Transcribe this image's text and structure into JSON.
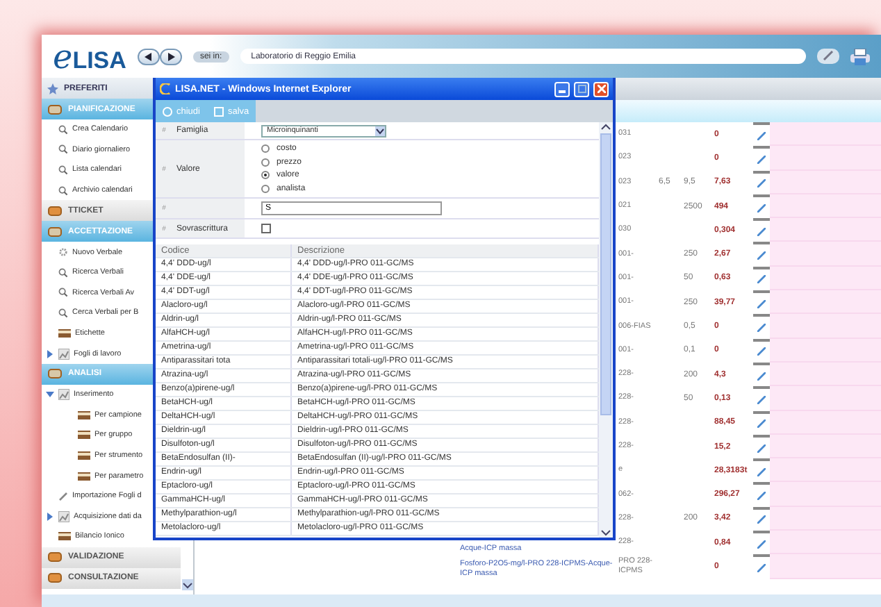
{
  "app": {
    "logo_prefix": "e",
    "logo": "LISA",
    "location_label": "sei in:",
    "location": "Laboratorio di Reggio Emilia"
  },
  "sidebar": {
    "items": [
      {
        "kind": "favorites",
        "label": "PREFERITI"
      },
      {
        "kind": "section",
        "label": "PIANIFICAZIONE",
        "open": true
      },
      {
        "kind": "search",
        "label": "Crea Calendario"
      },
      {
        "kind": "search",
        "label": "Diario giornaliero"
      },
      {
        "kind": "search",
        "label": "Lista calendari"
      },
      {
        "kind": "search",
        "label": "Archivio calendari"
      },
      {
        "kind": "section",
        "label": "TTICKET",
        "open": false
      },
      {
        "kind": "section",
        "label": "ACCETTAZIONE",
        "open": true
      },
      {
        "kind": "new",
        "label": "Nuovo Verbale"
      },
      {
        "kind": "search",
        "label": "Ricerca Verbali"
      },
      {
        "kind": "search",
        "label": "Ricerca Verbali Av"
      },
      {
        "kind": "search",
        "label": "Cerca Verbali per B"
      },
      {
        "kind": "tray",
        "label": "Etichette"
      },
      {
        "kind": "group",
        "label": "Fogli di lavoro",
        "expanded": false
      },
      {
        "kind": "section",
        "label": "ANALISI",
        "open": true
      },
      {
        "kind": "group",
        "label": "Inserimento",
        "expanded": true,
        "children": [
          {
            "kind": "tray",
            "label": "Per campione"
          },
          {
            "kind": "tray",
            "label": "Per gruppo"
          },
          {
            "kind": "tray",
            "label": "Per strumento"
          },
          {
            "kind": "tray",
            "label": "Per parametro"
          }
        ]
      },
      {
        "kind": "import",
        "label": "Importazione Fogli d"
      },
      {
        "kind": "group",
        "label": "Acquisizione dati da",
        "expanded": false
      },
      {
        "kind": "tray",
        "label": "Bilancio Ionico"
      },
      {
        "kind": "section",
        "label": "VALIDAZIONE",
        "open": false
      },
      {
        "kind": "section",
        "label": "CONSULTAZIONE",
        "open": false
      }
    ]
  },
  "results": {
    "rows": [
      {
        "code": "031",
        "min": "",
        "max": "",
        "value": "0"
      },
      {
        "code": "023",
        "min": "",
        "max": "",
        "value": "0"
      },
      {
        "code": "023",
        "min": "6,5",
        "max": "9,5",
        "value": "7,63"
      },
      {
        "code": "021",
        "min": "",
        "max": "2500",
        "value": "494"
      },
      {
        "code": "030",
        "min": "",
        "max": "",
        "value": "0,304"
      },
      {
        "code": "001-",
        "min": "",
        "max": "250",
        "value": "2,67"
      },
      {
        "code": "001-",
        "min": "",
        "max": "50",
        "value": "0,63"
      },
      {
        "code": "001-",
        "min": "",
        "max": "250",
        "value": "39,77"
      },
      {
        "code": "006-FIAS",
        "min": "",
        "max": "0,5",
        "value": "0"
      },
      {
        "code": "001-",
        "min": "",
        "max": "0,1",
        "value": "0"
      },
      {
        "code": "228-",
        "min": "",
        "max": "200",
        "value": "4,3"
      },
      {
        "code": "228-",
        "min": "",
        "max": "50",
        "value": "0,13"
      },
      {
        "code": "228-",
        "min": "",
        "max": "",
        "value": "88,45"
      },
      {
        "code": "228-",
        "min": "",
        "max": "",
        "value": "15,2"
      },
      {
        "code": "e",
        "min": "",
        "max": "",
        "value": "28,3183t"
      },
      {
        "code": "062-",
        "min": "",
        "max": "",
        "value": "296,27"
      },
      {
        "code": "228-",
        "min": "",
        "max": "200",
        "value": "3,42"
      },
      {
        "code": "228-",
        "min": "",
        "max": "",
        "value": "0,84",
        "desc": "Acque-ICP massa"
      },
      {
        "code": "PRO 228-ICPMS",
        "min": "",
        "max": "",
        "value": "0",
        "desc": "Fosforo-P2O5-mg/l-PRO 228-ICPMS-Acque-ICP massa"
      }
    ]
  },
  "popup": {
    "title": "LISA.NET - Windows Internet Explorer",
    "toolbar": [
      {
        "kind": "close",
        "label": "chiudi"
      },
      {
        "kind": "save",
        "label": "salva"
      }
    ],
    "marker": "#",
    "family": {
      "label": "Famiglia",
      "value": "Microinquinanti"
    },
    "value_choice": {
      "label": "Valore",
      "options": [
        {
          "label": "costo",
          "selected": false
        },
        {
          "label": "prezzo",
          "selected": false
        },
        {
          "label": "valore",
          "selected": true
        },
        {
          "label": "analista",
          "selected": false
        }
      ]
    },
    "text_value": "S",
    "overwrite": {
      "label": "Sovrascrittura",
      "checked": false
    },
    "table": {
      "columns": [
        "Codice",
        "Descrizione"
      ],
      "rows": [
        {
          "code": "4,4' DDD-ug/l",
          "desc": "4,4' DDD-ug/l-PRO 011-GC/MS"
        },
        {
          "code": "4,4' DDE-ug/l",
          "desc": "4,4' DDE-ug/l-PRO 011-GC/MS"
        },
        {
          "code": "4,4' DDT-ug/l",
          "desc": "4,4' DDT-ug/l-PRO 011-GC/MS"
        },
        {
          "code": "Alacloro-ug/l",
          "desc": "Alacloro-ug/l-PRO 011-GC/MS"
        },
        {
          "code": "Aldrin-ug/l",
          "desc": "Aldrin-ug/l-PRO 011-GC/MS"
        },
        {
          "code": "AlfaHCH-ug/l",
          "desc": "AlfaHCH-ug/l-PRO 011-GC/MS"
        },
        {
          "code": "Ametrina-ug/l",
          "desc": "Ametrina-ug/l-PRO 011-GC/MS"
        },
        {
          "code": "Antiparassitari tota",
          "desc": "Antiparassitari totali-ug/l-PRO 011-GC/MS"
        },
        {
          "code": "Atrazina-ug/l",
          "desc": "Atrazina-ug/l-PRO 011-GC/MS"
        },
        {
          "code": "Benzo(a)pirene-ug/l",
          "desc": "Benzo(a)pirene-ug/l-PRO 011-GC/MS"
        },
        {
          "code": "BetaHCH-ug/l",
          "desc": "BetaHCH-ug/l-PRO 011-GC/MS"
        },
        {
          "code": "DeltaHCH-ug/l",
          "desc": "DeltaHCH-ug/l-PRO 011-GC/MS"
        },
        {
          "code": "Dieldrin-ug/l",
          "desc": "Dieldrin-ug/l-PRO 011-GC/MS"
        },
        {
          "code": "Disulfoton-ug/l",
          "desc": "Disulfoton-ug/l-PRO 011-GC/MS"
        },
        {
          "code": "BetaEndosulfan (II)-",
          "desc": "BetaEndosulfan (II)-ug/l-PRO 011-GC/MS"
        },
        {
          "code": "Endrin-ug/l",
          "desc": "Endrin-ug/l-PRO 011-GC/MS"
        },
        {
          "code": "Eptacloro-ug/l",
          "desc": "Eptacloro-ug/l-PRO 011-GC/MS"
        },
        {
          "code": "GammaHCH-ug/l",
          "desc": "GammaHCH-ug/l-PRO 011-GC/MS"
        },
        {
          "code": "Methylparathion-ug/l",
          "desc": "Methylparathion-ug/l-PRO 011-GC/MS"
        },
        {
          "code": "Metolacloro-ug/l",
          "desc": "Metolacloro-ug/l-PRO 011-GC/MS"
        }
      ]
    }
  }
}
